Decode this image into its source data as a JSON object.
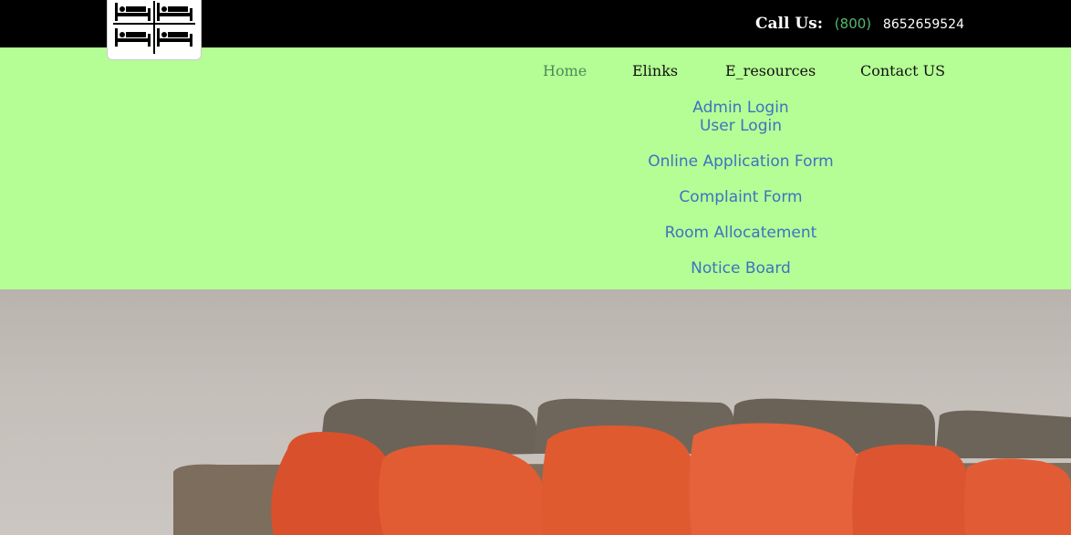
{
  "header": {
    "logo_icon": "hostel-beds-icon",
    "call_label": "Call Us:",
    "area_code": "(800)",
    "phone": "8652659524",
    "accent_color": "#58b86c"
  },
  "nav": {
    "items": [
      {
        "label": "Home",
        "active": true
      },
      {
        "label": "Elinks"
      },
      {
        "label": "E_resources"
      },
      {
        "label": "Contact US"
      }
    ],
    "band_color": "#b5fe95"
  },
  "dropdown": {
    "items": [
      {
        "label": "Admin Login"
      },
      {
        "label": "User Login"
      },
      {
        "label": "Online Application Form"
      },
      {
        "label": "Complaint Form"
      },
      {
        "label": "Room Allocatement"
      },
      {
        "label": "Notice Board"
      }
    ],
    "link_color": "#3e72c2"
  },
  "hero": {
    "image": "sofa-with-orange-cushions"
  }
}
